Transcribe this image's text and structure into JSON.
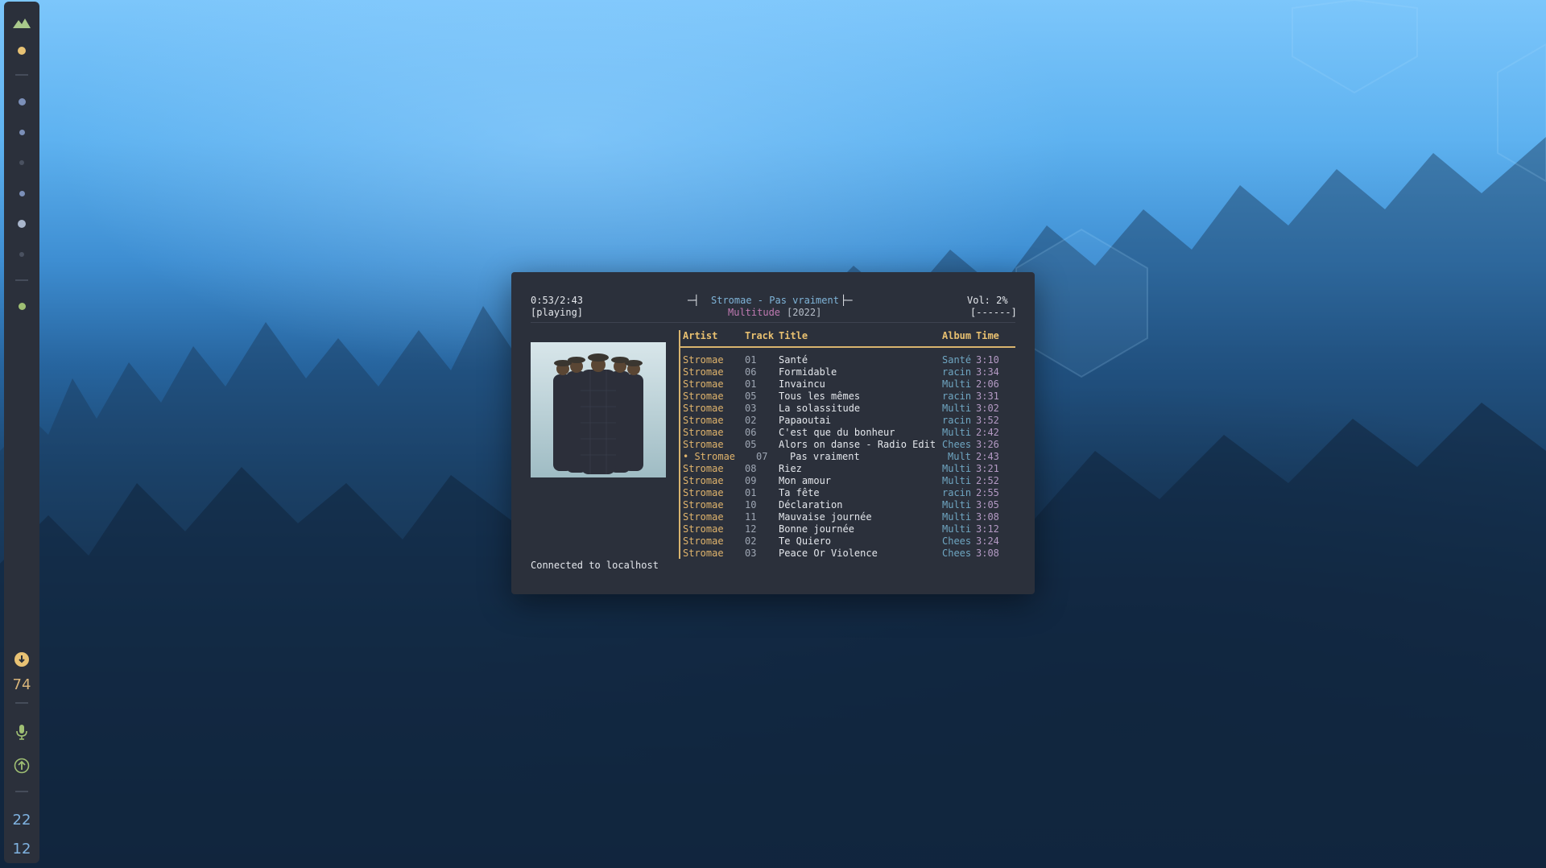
{
  "sidebar": {
    "battery_value": "74",
    "clock_hours": "22",
    "clock_minutes": "12",
    "workspace_dots": [
      "active",
      "occupied",
      "occupied",
      "empty",
      "occupied",
      "occupied",
      "empty"
    ],
    "colors": {
      "yellow": "#e8c274",
      "blue": "#7b8fb8",
      "green": "#9fbf73",
      "dim": "#4a5160"
    }
  },
  "player": {
    "elapsed_total": "0:53/2:43",
    "state": "[playing]",
    "now_playing": "Stromae - Pas vraiment",
    "album": "Multitude",
    "year": "[2022]",
    "volume": "Vol: 2%",
    "volume_bar": "[------]",
    "status_message": "Connected to localhost"
  },
  "table": {
    "headers": {
      "artist": "Artist",
      "track": "Track",
      "title": "Title",
      "album": "Album",
      "time": "Time"
    },
    "rows": [
      {
        "artist": "Stromae",
        "track": "01",
        "title": "Santé",
        "album": "Santé",
        "time": "3:10"
      },
      {
        "artist": "Stromae",
        "track": "06",
        "title": "Formidable",
        "album": "racin",
        "time": "3:34"
      },
      {
        "artist": "Stromae",
        "track": "01",
        "title": "Invaincu",
        "album": "Multi",
        "time": "2:06"
      },
      {
        "artist": "Stromae",
        "track": "05",
        "title": "Tous les mêmes",
        "album": "racin",
        "time": "3:31"
      },
      {
        "artist": "Stromae",
        "track": "03",
        "title": "La solassitude",
        "album": "Multi",
        "time": "3:02"
      },
      {
        "artist": "Stromae",
        "track": "02",
        "title": "Papaoutai",
        "album": "racin",
        "time": "3:52"
      },
      {
        "artist": "Stromae",
        "track": "06",
        "title": "C'est que du bonheur",
        "album": "Multi",
        "time": "2:42"
      },
      {
        "artist": "Stromae",
        "track": "05",
        "title": "Alors on danse - Radio Edit",
        "album": "Chees",
        "time": "3:26"
      },
      {
        "artist": "• Stromae",
        "track": "07",
        "title": "Pas vraiment",
        "album": "Mult",
        "time": "2:43",
        "current": true
      },
      {
        "artist": "Stromae",
        "track": "08",
        "title": "Riez",
        "album": "Multi",
        "time": "3:21"
      },
      {
        "artist": "Stromae",
        "track": "09",
        "title": "Mon amour",
        "album": "Multi",
        "time": "2:52"
      },
      {
        "artist": "Stromae",
        "track": "01",
        "title": "Ta fête",
        "album": "racin",
        "time": "2:55"
      },
      {
        "artist": "Stromae",
        "track": "10",
        "title": "Déclaration",
        "album": "Multi",
        "time": "3:05"
      },
      {
        "artist": "Stromae",
        "track": "11",
        "title": "Mauvaise journée",
        "album": "Multi",
        "time": "3:08"
      },
      {
        "artist": "Stromae",
        "track": "12",
        "title": "Bonne journée",
        "album": "Multi",
        "time": "3:12"
      },
      {
        "artist": "Stromae",
        "track": "02",
        "title": "Te Quiero",
        "album": "Chees",
        "time": "3:24"
      },
      {
        "artist": "Stromae",
        "track": "03",
        "title": "Peace Or Violence",
        "album": "Chees",
        "time": "3:08"
      }
    ]
  }
}
